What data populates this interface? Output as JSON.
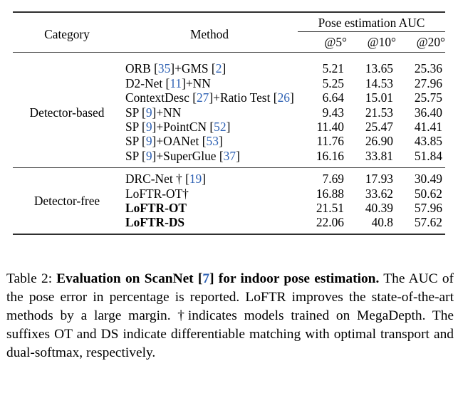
{
  "table": {
    "label": "Table 2",
    "header": {
      "category": "Category",
      "method": "Method",
      "group": "Pose estimation AUC",
      "sub": [
        "@5°",
        "@10°",
        "@20°"
      ]
    },
    "sections": [
      {
        "category": "Detector-based",
        "rows": [
          {
            "method_parts": [
              {
                "t": "ORB ",
                "cite": false,
                "bold": false
              },
              {
                "t": "[",
                "cite": false,
                "bold": false
              },
              {
                "t": "35",
                "cite": true,
                "bold": false
              },
              {
                "t": "]+GMS [",
                "cite": false,
                "bold": false
              },
              {
                "t": "2",
                "cite": true,
                "bold": false
              },
              {
                "t": "]",
                "cite": false,
                "bold": false
              }
            ],
            "method_text": "ORB [35]+GMS [2]",
            "values": [
              "5.21",
              "13.65",
              "25.36"
            ],
            "bold_values": [
              false,
              false,
              false
            ]
          },
          {
            "method_parts": [
              {
                "t": "D2-Net ",
                "cite": false,
                "bold": false
              },
              {
                "t": "[",
                "cite": false,
                "bold": false
              },
              {
                "t": "11",
                "cite": true,
                "bold": false
              },
              {
                "t": "]+NN",
                "cite": false,
                "bold": false
              }
            ],
            "method_text": "D2-Net [11]+NN",
            "values": [
              "5.25",
              "14.53",
              "27.96"
            ],
            "bold_values": [
              false,
              false,
              false
            ]
          },
          {
            "method_parts": [
              {
                "t": "ContextDesc ",
                "cite": false,
                "bold": false
              },
              {
                "t": "[",
                "cite": false,
                "bold": false
              },
              {
                "t": "27",
                "cite": true,
                "bold": false
              },
              {
                "t": "]+Ratio Test [",
                "cite": false,
                "bold": false
              },
              {
                "t": "26",
                "cite": true,
                "bold": false
              },
              {
                "t": "]",
                "cite": false,
                "bold": false
              }
            ],
            "method_text": "ContextDesc [27]+Ratio Test [26]",
            "values": [
              "6.64",
              "15.01",
              "25.75"
            ],
            "bold_values": [
              false,
              false,
              false
            ]
          },
          {
            "method_parts": [
              {
                "t": "SP ",
                "cite": false,
                "bold": false
              },
              {
                "t": "[",
                "cite": false,
                "bold": false
              },
              {
                "t": "9",
                "cite": true,
                "bold": false
              },
              {
                "t": "]+NN",
                "cite": false,
                "bold": false
              }
            ],
            "method_text": "SP [9]+NN",
            "values": [
              "9.43",
              "21.53",
              "36.40"
            ],
            "bold_values": [
              false,
              false,
              false
            ]
          },
          {
            "method_parts": [
              {
                "t": "SP ",
                "cite": false,
                "bold": false
              },
              {
                "t": "[",
                "cite": false,
                "bold": false
              },
              {
                "t": "9",
                "cite": true,
                "bold": false
              },
              {
                "t": "]+PointCN [",
                "cite": false,
                "bold": false
              },
              {
                "t": "52",
                "cite": true,
                "bold": false
              },
              {
                "t": "]",
                "cite": false,
                "bold": false
              }
            ],
            "method_text": "SP [9]+PointCN [52]",
            "values": [
              "11.40",
              "25.47",
              "41.41"
            ],
            "bold_values": [
              false,
              false,
              false
            ]
          },
          {
            "method_parts": [
              {
                "t": "SP ",
                "cite": false,
                "bold": false
              },
              {
                "t": "[",
                "cite": false,
                "bold": false
              },
              {
                "t": "9",
                "cite": true,
                "bold": false
              },
              {
                "t": "]+OANet [",
                "cite": false,
                "bold": false
              },
              {
                "t": "53",
                "cite": true,
                "bold": false
              },
              {
                "t": "]",
                "cite": false,
                "bold": false
              }
            ],
            "method_text": "SP [9]+OANet [53]",
            "values": [
              "11.76",
              "26.90",
              "43.85"
            ],
            "bold_values": [
              false,
              false,
              false
            ]
          },
          {
            "method_parts": [
              {
                "t": "SP ",
                "cite": false,
                "bold": false
              },
              {
                "t": "[",
                "cite": false,
                "bold": false
              },
              {
                "t": "9",
                "cite": true,
                "bold": false
              },
              {
                "t": "]+SuperGlue [",
                "cite": false,
                "bold": false
              },
              {
                "t": "37",
                "cite": true,
                "bold": false
              },
              {
                "t": "]",
                "cite": false,
                "bold": false
              }
            ],
            "method_text": "SP [9]+SuperGlue [37]",
            "values": [
              "16.16",
              "33.81",
              "51.84"
            ],
            "bold_values": [
              false,
              false,
              false
            ]
          }
        ]
      },
      {
        "category": "Detector-free",
        "rows": [
          {
            "method_parts": [
              {
                "t": "DRC-Net † ",
                "cite": false,
                "bold": false
              },
              {
                "t": "[",
                "cite": false,
                "bold": false
              },
              {
                "t": "19",
                "cite": true,
                "bold": false
              },
              {
                "t": "]",
                "cite": false,
                "bold": false
              }
            ],
            "method_text": "DRC-Net † [19]",
            "values": [
              "7.69",
              "17.93",
              "30.49"
            ],
            "bold_values": [
              false,
              false,
              false
            ]
          },
          {
            "method_parts": [
              {
                "t": "LoFTR-OT†",
                "cite": false,
                "bold": false
              }
            ],
            "method_text": "LoFTR-OT†",
            "values": [
              "16.88",
              "33.62",
              "50.62"
            ],
            "bold_values": [
              false,
              false,
              false
            ]
          },
          {
            "method_parts": [
              {
                "t": "LoFTR-OT",
                "cite": false,
                "bold": true
              }
            ],
            "method_text": "LoFTR-OT",
            "values": [
              "21.51",
              "40.39",
              "57.96"
            ],
            "bold_values": [
              false,
              false,
              true
            ]
          },
          {
            "method_parts": [
              {
                "t": "LoFTR-DS",
                "cite": false,
                "bold": true
              }
            ],
            "method_text": "LoFTR-DS",
            "values": [
              "22.06",
              "40.8",
              "57.62"
            ],
            "bold_values": [
              true,
              true,
              false
            ]
          }
        ]
      }
    ]
  },
  "caption": {
    "prefix": "Table 2:",
    "bold_title": "Evaluation on ScanNet [7] for indoor pose estimation.",
    "bold_title_pre": "Evaluation on ScanNet [",
    "bold_cite": "7",
    "bold_title_post": "] for indoor pose estimation.",
    "body": "The AUC of the pose error in percentage is reported. LoFTR improves the state-of-the-art methods by a large margin. †indicates models trained on MegaDepth. The suffixes OT and DS indicate differentiable matching with optimal transport and dual-softmax, respectively."
  },
  "colors": {
    "citation_blue": "#2f62b4",
    "rule_dark": "#2f2f2f",
    "rule_mid": "#4a4a4a",
    "text": "#000000",
    "background": "#ffffff"
  }
}
